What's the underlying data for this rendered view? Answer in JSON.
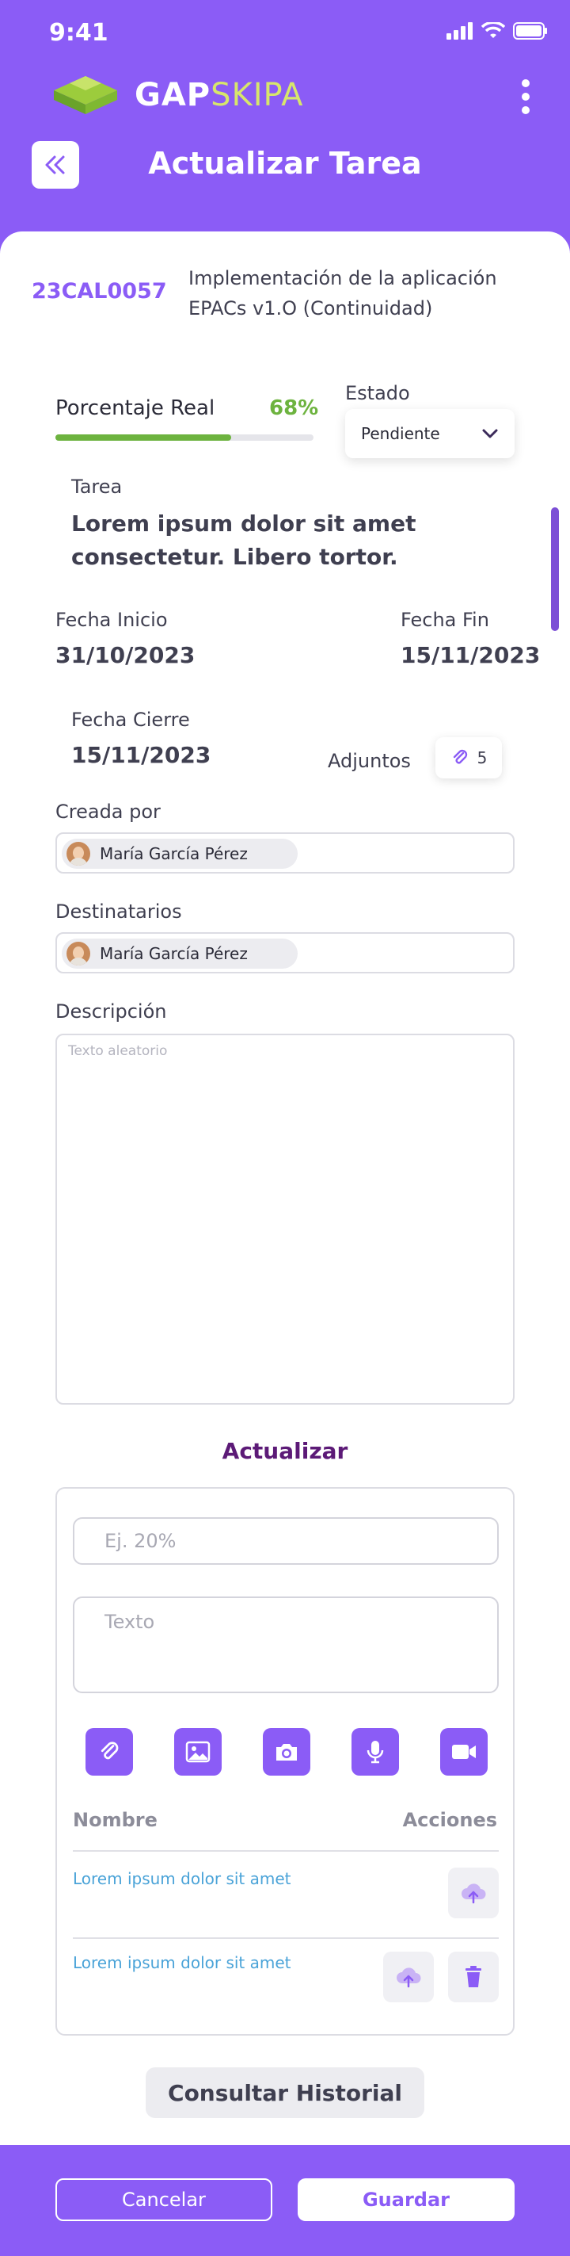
{
  "status_bar": {
    "time": "9:41"
  },
  "brand": {
    "part1": "GAP",
    "part2": "SKIPA"
  },
  "header": {
    "title": "Actualizar Tarea"
  },
  "task": {
    "code": "23CAL0057",
    "project": "Implementación de la aplicación EPACs v1.O (Continuidad)",
    "percent_label": "Porcentaje Real",
    "percent_value": "68%",
    "percent_fraction": 0.68,
    "estado_label": "Estado",
    "estado_value": "Pendiente",
    "tarea_label": "Tarea",
    "tarea_value": "Lorem ipsum dolor sit amet consectetur. Libero tortor.",
    "fecha_inicio_label": "Fecha Inicio",
    "fecha_inicio_value": "31/10/2023",
    "fecha_fin_label": "Fecha Fin",
    "fecha_fin_value": "15/11/2023",
    "fecha_cierre_label": "Fecha Cierre",
    "fecha_cierre_value": "15/11/2023",
    "adjuntos_label": "Adjuntos",
    "adjuntos_count": "5",
    "creada_por_label": "Creada por",
    "creada_por_value": "María García Pérez",
    "destinatarios_label": "Destinatarios",
    "destinatarios_value": "María García Pérez",
    "descripcion_label": "Descripción",
    "descripcion_placeholder": "Texto aleatorio"
  },
  "update": {
    "title": "Actualizar",
    "percent_placeholder": "Ej. 20%",
    "text_placeholder": "Texto",
    "tools": [
      "paperclip-icon",
      "image-icon",
      "camera-icon",
      "microphone-icon",
      "video-icon"
    ],
    "col_name": "Nombre",
    "col_actions": "Acciones",
    "files": [
      {
        "name": "Lorem ipsum dolor sit amet"
      },
      {
        "name": "Lorem ipsum dolor sit amet"
      }
    ]
  },
  "historial_label": "Consultar Historial",
  "footer": {
    "cancel_label": "Cancelar",
    "save_label": "Guardar"
  },
  "colors": {
    "primary": "#8b5cf6",
    "progress": "#6db33f",
    "title_dark": "#5c1a77",
    "link": "#4aa3d8",
    "logo_accent": "#d7e66b"
  }
}
